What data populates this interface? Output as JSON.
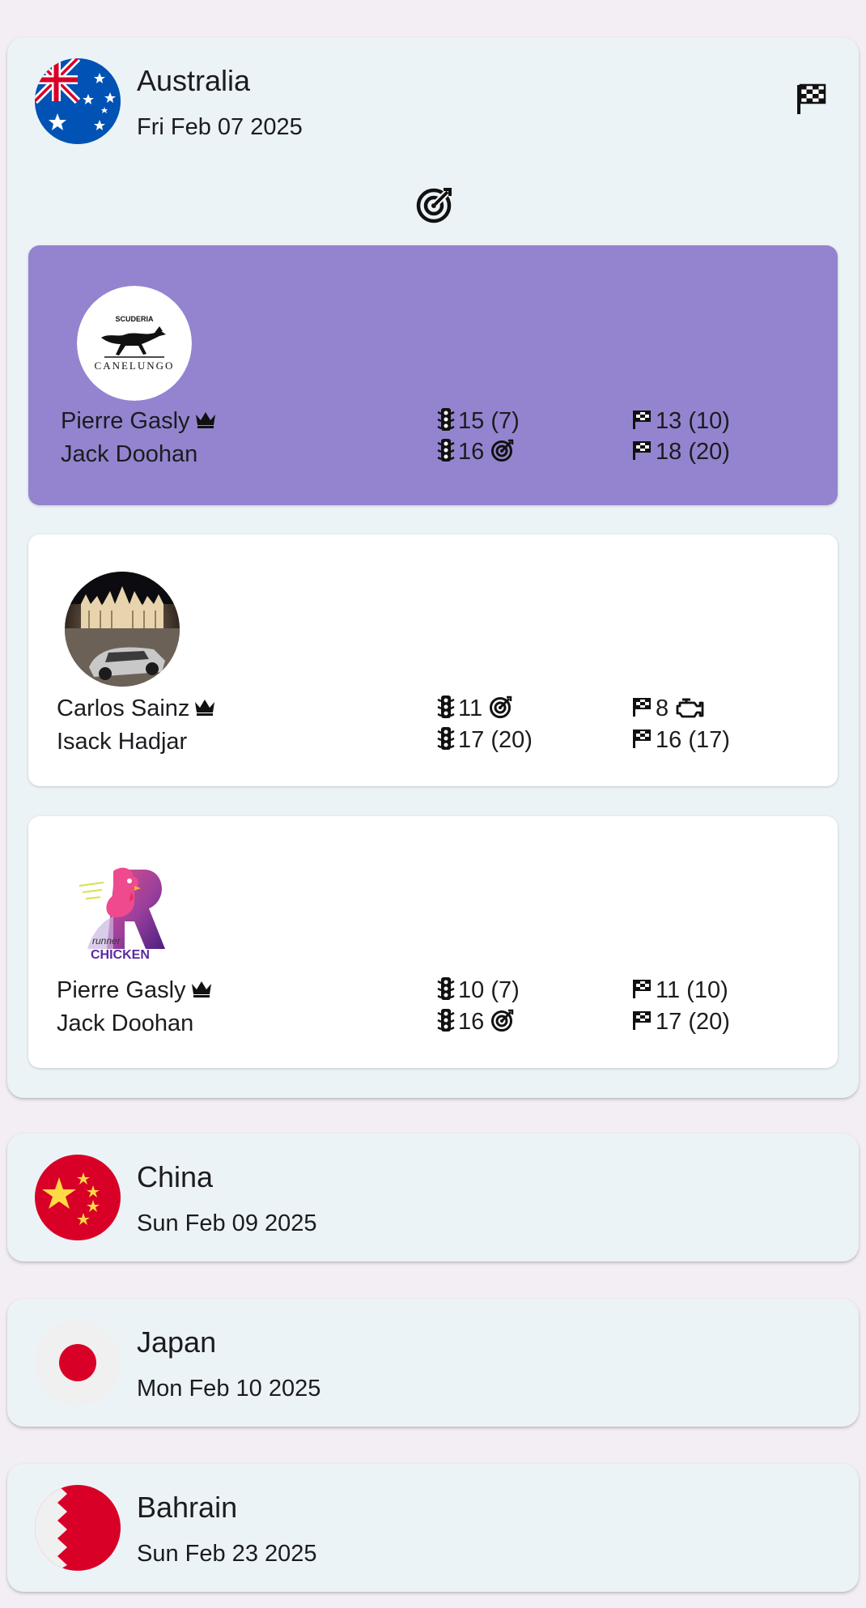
{
  "races": [
    {
      "name": "Australia",
      "date": "Fri Feb 07 2025",
      "flag_icon": "australia-flag",
      "status_icon": "checkered-flag-icon",
      "expanded": true,
      "teams": [
        {
          "logo": "scuderia-canelungo-logo",
          "selected": true,
          "background": "#9484cf",
          "drivers": [
            {
              "name": "Pierre Gasly",
              "captain": true,
              "qualifying": "15 (7)",
              "race": "13 (10)"
            },
            {
              "name": "Jack Doohan",
              "captain": false,
              "qualifying": "16",
              "qualifying_icon": "target-icon",
              "race": "18 (20)"
            }
          ]
        },
        {
          "logo": "milan-cathedral-photo-logo",
          "selected": false,
          "background": "#ffffff",
          "drivers": [
            {
              "name": "Carlos Sainz",
              "captain": true,
              "qualifying": "11",
              "qualifying_icon": "target-icon",
              "race": "8",
              "race_icon": "engine-icon"
            },
            {
              "name": "Isack Hadjar",
              "captain": false,
              "qualifying": "17 (20)",
              "race": "16 (17)"
            }
          ]
        },
        {
          "logo": "runner-chicken-logo",
          "logo_text": "runner CHICKEN",
          "selected": false,
          "background": "#ffffff",
          "drivers": [
            {
              "name": "Pierre Gasly",
              "captain": true,
              "qualifying": "10 (7)",
              "race": "11 (10)"
            },
            {
              "name": "Jack Doohan",
              "captain": false,
              "qualifying": "16",
              "qualifying_icon": "target-icon",
              "race": "17 (20)"
            }
          ]
        }
      ]
    },
    {
      "name": "China",
      "date": "Sun Feb 09 2025",
      "flag_icon": "china-flag"
    },
    {
      "name": "Japan",
      "date": "Mon Feb 10 2025",
      "flag_icon": "japan-flag"
    },
    {
      "name": "Bahrain",
      "date": "Sun Feb 23 2025",
      "flag_icon": "bahrain-flag"
    }
  ],
  "logo_text": {
    "scuderia": "SCUDERIA",
    "canelungo": "CANELUNGO",
    "runner": "runner",
    "chicken": "CHICKEN"
  },
  "colors": {
    "page_bg": "#f3eef4",
    "card_bg": "#ebf3f7",
    "selected_team": "#9484cf",
    "flag_red": "#d80027",
    "flag_blue": "#0052b4",
    "china_yellow": "#ffda44"
  }
}
